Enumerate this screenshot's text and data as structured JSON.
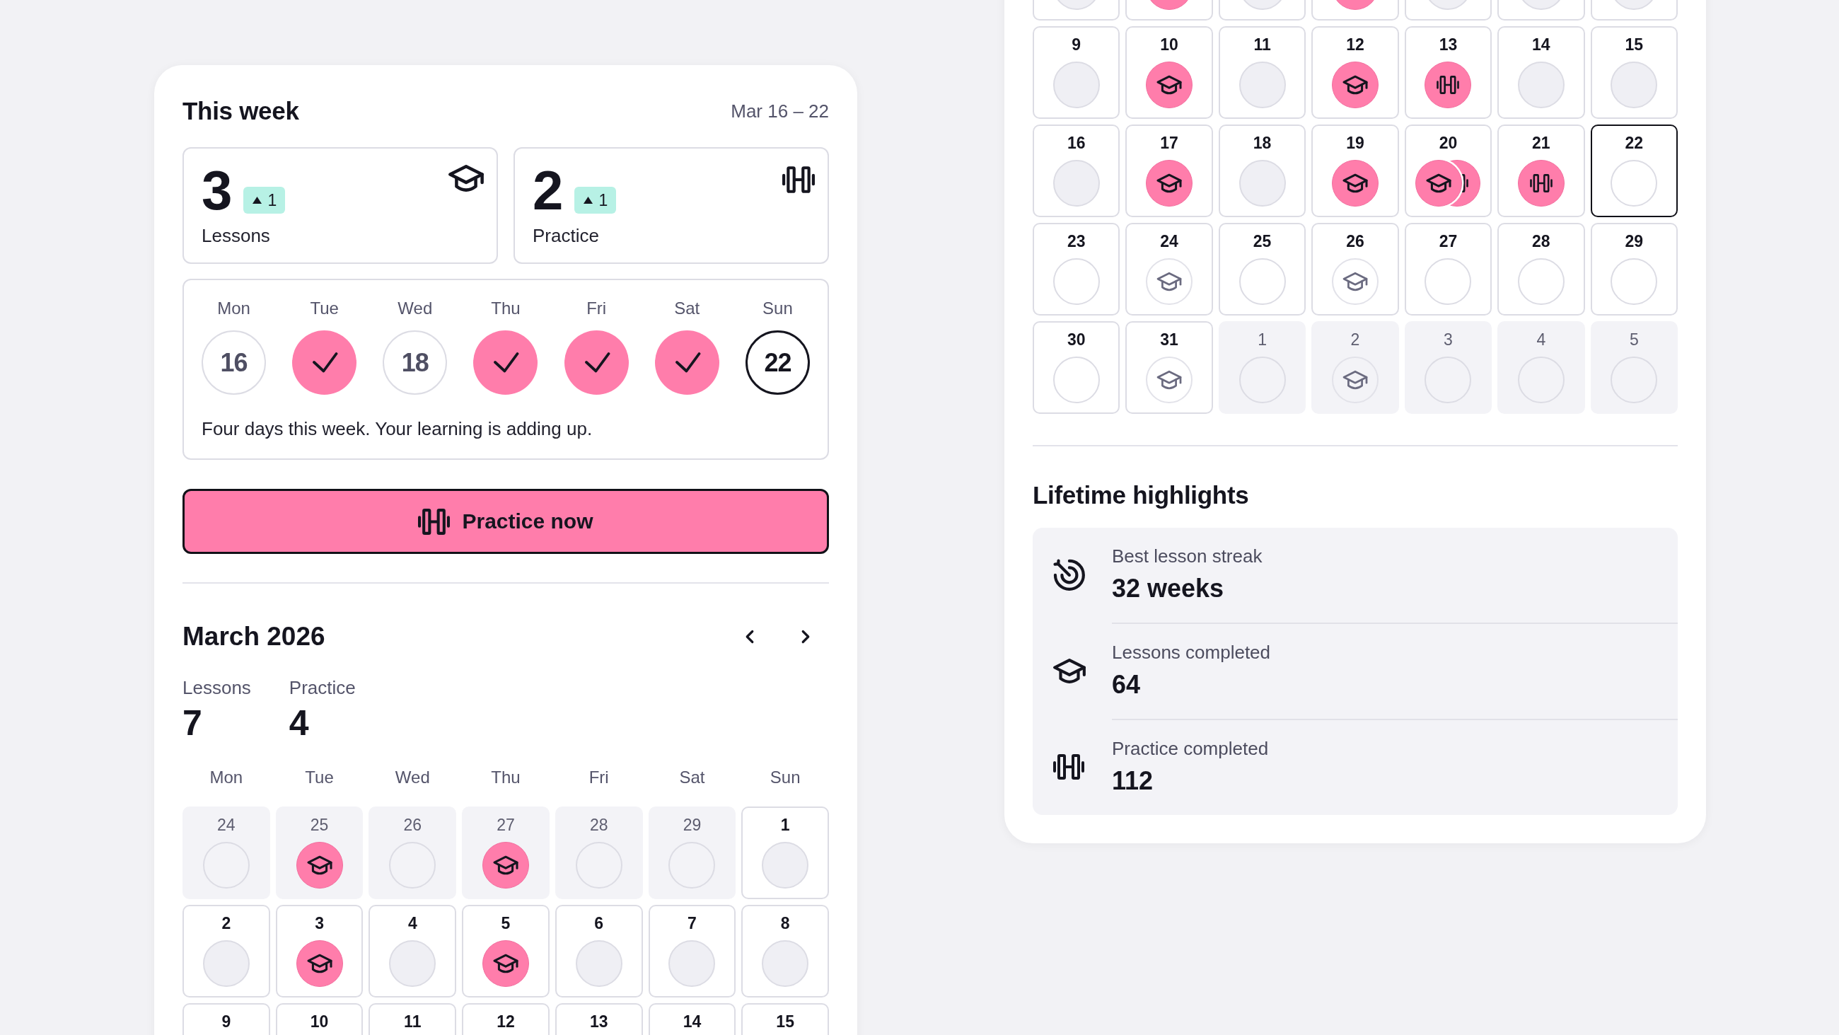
{
  "this_week": {
    "title": "This week",
    "range": "Mar 16 – 22",
    "stats": [
      {
        "kind": "lessons",
        "value": "3",
        "change": {
          "kind": "up",
          "value": "1"
        },
        "label": "Lessons"
      },
      {
        "kind": "practice",
        "value": "2",
        "change": {
          "kind": "up",
          "value": "1"
        },
        "label": "Practice"
      }
    ],
    "days": [
      {
        "weekday": "Mon",
        "date": "16",
        "done": false,
        "today": false
      },
      {
        "weekday": "Tue",
        "done": true,
        "today": false
      },
      {
        "weekday": "Wed",
        "date": "18",
        "done": false,
        "today": false
      },
      {
        "weekday": "Thu",
        "done": true,
        "today": false
      },
      {
        "weekday": "Fri",
        "done": true,
        "today": false
      },
      {
        "weekday": "Sat",
        "done": true,
        "today": false
      },
      {
        "weekday": "Sun",
        "date": "22",
        "done": false,
        "today": true
      }
    ],
    "message": "Four days this week. Your learning is adding up."
  },
  "practice_button": {
    "label": "Practice now"
  },
  "month": {
    "title": "March 2026",
    "totals": [
      {
        "label": "Lessons",
        "value": "7"
      },
      {
        "label": "Practice",
        "value": "4"
      }
    ],
    "weekdays": [
      "Mon",
      "Tue",
      "Wed",
      "Thu",
      "Fri",
      "Sat",
      "Sun"
    ],
    "weeks": [
      {
        "days": [
          {
            "day": "24",
            "in_month": false,
            "today": false,
            "kind": "none"
          },
          {
            "day": "25",
            "in_month": false,
            "today": false,
            "kind": "lesson"
          },
          {
            "day": "26",
            "in_month": false,
            "today": false,
            "kind": "none"
          },
          {
            "day": "27",
            "in_month": false,
            "today": false,
            "kind": "lesson"
          },
          {
            "day": "28",
            "in_month": false,
            "today": false,
            "kind": "none"
          },
          {
            "day": "29",
            "in_month": false,
            "today": false,
            "kind": "none"
          },
          {
            "day": "1",
            "in_month": true,
            "today": false,
            "kind": "none",
            "past": true
          }
        ]
      },
      {
        "days": [
          {
            "day": "2",
            "in_month": true,
            "today": false,
            "kind": "none",
            "past": true
          },
          {
            "day": "3",
            "in_month": true,
            "today": false,
            "kind": "lesson"
          },
          {
            "day": "4",
            "in_month": true,
            "today": false,
            "kind": "none",
            "past": true
          },
          {
            "day": "5",
            "in_month": true,
            "today": false,
            "kind": "lesson"
          },
          {
            "day": "6",
            "in_month": true,
            "today": false,
            "kind": "none",
            "past": true
          },
          {
            "day": "7",
            "in_month": true,
            "today": false,
            "kind": "none",
            "past": true
          },
          {
            "day": "8",
            "in_month": true,
            "today": false,
            "kind": "none",
            "past": true
          }
        ]
      },
      {
        "days": [
          {
            "day": "9",
            "in_month": true,
            "today": false
          },
          {
            "day": "10",
            "in_month": true,
            "today": false
          },
          {
            "day": "11",
            "in_month": true,
            "today": false
          },
          {
            "day": "12",
            "in_month": true,
            "today": false
          },
          {
            "day": "13",
            "in_month": true,
            "today": false
          },
          {
            "day": "14",
            "in_month": true,
            "today": false
          },
          {
            "day": "15",
            "in_month": true,
            "today": false
          }
        ]
      }
    ]
  },
  "month_continued": {
    "weeks": [
      {
        "days": [
          {
            "in_month": true,
            "today": false,
            "kind": "none",
            "past": true
          },
          {
            "in_month": true,
            "today": false,
            "kind": "lesson"
          },
          {
            "in_month": true,
            "today": false,
            "kind": "none",
            "past": true
          },
          {
            "in_month": true,
            "today": false,
            "kind": "lesson"
          },
          {
            "in_month": true,
            "today": false,
            "kind": "none",
            "past": true
          },
          {
            "in_month": true,
            "today": false,
            "kind": "none",
            "past": true
          },
          {
            "in_month": true,
            "today": false,
            "kind": "none",
            "past": true
          }
        ]
      },
      {
        "days": [
          {
            "day": "9",
            "in_month": true,
            "today": false,
            "kind": "none",
            "past": true
          },
          {
            "day": "10",
            "in_month": true,
            "today": false,
            "kind": "lesson"
          },
          {
            "day": "11",
            "in_month": true,
            "today": false,
            "kind": "none",
            "past": true
          },
          {
            "day": "12",
            "in_month": true,
            "today": false,
            "kind": "lesson"
          },
          {
            "day": "13",
            "in_month": true,
            "today": false,
            "kind": "practice"
          },
          {
            "day": "14",
            "in_month": true,
            "today": false,
            "kind": "none",
            "past": true
          },
          {
            "day": "15",
            "in_month": true,
            "today": false,
            "kind": "none",
            "past": true
          }
        ]
      },
      {
        "days": [
          {
            "day": "16",
            "in_month": true,
            "today": false,
            "kind": "none",
            "past": true
          },
          {
            "day": "17",
            "in_month": true,
            "today": false,
            "kind": "lesson"
          },
          {
            "day": "18",
            "in_month": true,
            "today": false,
            "kind": "none",
            "past": true
          },
          {
            "day": "19",
            "in_month": true,
            "today": false,
            "kind": "lesson"
          },
          {
            "day": "20",
            "in_month": true,
            "today": false,
            "kind": "both"
          },
          {
            "day": "21",
            "in_month": true,
            "today": false,
            "kind": "practice"
          },
          {
            "day": "22",
            "in_month": true,
            "today": true,
            "kind": "none",
            "past": false
          }
        ]
      },
      {
        "days": [
          {
            "day": "23",
            "in_month": true,
            "today": false,
            "kind": "none",
            "past": false
          },
          {
            "day": "24",
            "in_month": true,
            "today": false,
            "kind": "planned_lesson"
          },
          {
            "day": "25",
            "in_month": true,
            "today": false,
            "kind": "none",
            "past": false
          },
          {
            "day": "26",
            "in_month": true,
            "today": false,
            "kind": "planned_lesson"
          },
          {
            "day": "27",
            "in_month": true,
            "today": false,
            "kind": "none",
            "past": false
          },
          {
            "day": "28",
            "in_month": true,
            "today": false,
            "kind": "none",
            "past": false
          },
          {
            "day": "29",
            "in_month": true,
            "today": false,
            "kind": "none",
            "past": false
          }
        ]
      },
      {
        "days": [
          {
            "day": "30",
            "in_month": true,
            "today": false,
            "kind": "none",
            "past": false
          },
          {
            "day": "31",
            "in_month": true,
            "today": false,
            "kind": "planned_lesson"
          },
          {
            "day": "1",
            "in_month": false,
            "today": false,
            "kind": "none"
          },
          {
            "day": "2",
            "in_month": false,
            "today": false,
            "kind": "planned_lesson"
          },
          {
            "day": "3",
            "in_month": false,
            "today": false,
            "kind": "none"
          },
          {
            "day": "4",
            "in_month": false,
            "today": false,
            "kind": "none"
          },
          {
            "day": "5",
            "in_month": false,
            "today": false,
            "kind": "none"
          }
        ]
      }
    ]
  },
  "lifetime_highlights": {
    "title": "Lifetime highlights",
    "items": [
      {
        "kind": "streak",
        "label": "Best lesson streak",
        "value": "32 weeks"
      },
      {
        "kind": "lessons",
        "label": "Lessons completed",
        "value": "64"
      },
      {
        "kind": "practice",
        "label": "Practice completed",
        "value": "112"
      }
    ]
  }
}
